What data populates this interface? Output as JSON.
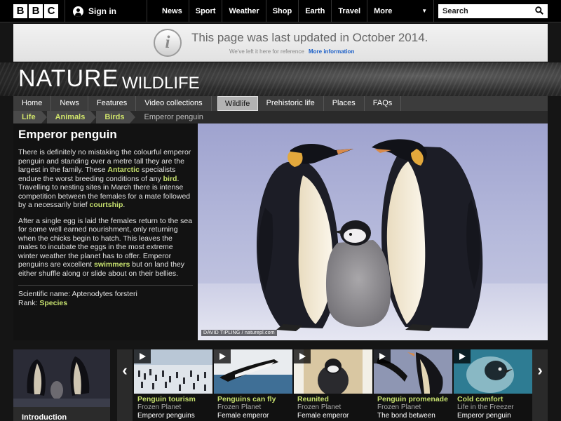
{
  "topbar": {
    "logo_letters": [
      "B",
      "B",
      "C"
    ],
    "signin_label": "Sign in",
    "nav": [
      "News",
      "Sport",
      "Weather",
      "Shop",
      "Earth",
      "Travel"
    ],
    "more_label": "More",
    "search_placeholder": "Search"
  },
  "notice": {
    "message": "This page was last updated in October 2014.",
    "sub_text": "We've left it here for reference",
    "more_info_link": "More information"
  },
  "header": {
    "site_title": "NATURE",
    "section_title": "WILDLIFE"
  },
  "nav": {
    "items": [
      "Home",
      "News",
      "Features",
      "Video collections",
      "Wildlife",
      "Prehistoric life",
      "Places",
      "FAQs"
    ],
    "active": "Wildlife"
  },
  "breadcrumb": [
    "Life",
    "Animals",
    "Birds",
    "Emperor penguin"
  ],
  "article": {
    "title": "Emperor penguin",
    "p1": {
      "t1": "There is definitely no mistaking the colourful emperor penguin and standing over a metre tall they are the largest in the family. These ",
      "link1": "Antarctic",
      "t2": " specialists endure the worst breeding conditions of any ",
      "link2": "bird",
      "t3": ". Travelling to nesting sites in March there is intense competition between the females for a mate followed by a necessarily brief ",
      "link3": "courtship",
      "t4": "."
    },
    "p2": {
      "t1": "After a single egg is laid the females return to the sea for some well earned nourishment, only returning when the chicks begin to hatch. This leaves the males to incubate the eggs in the most extreme winter weather the planet has to offer. Emperor penguins are excellent ",
      "link1": "swimmers",
      "t2": " but on land they either shuffle along or slide about on their bellies."
    },
    "scientific_name_label": "Scientific name: Aptenodytes forsteri",
    "rank_label": "Rank: ",
    "rank_link": "Species"
  },
  "hero": {
    "credit": "DAVID TIPLING / naturepl.com"
  },
  "strip": {
    "feature_label": "Introduction",
    "clips": [
      {
        "title": "Penguin tourism",
        "programme": "Frozen Planet",
        "desc": "Emperor penguins"
      },
      {
        "title": "Penguins can fly",
        "programme": "Frozen Planet",
        "desc": "Female emperor"
      },
      {
        "title": "Reunited",
        "programme": "Frozen Planet",
        "desc": "Female emperor"
      },
      {
        "title": "Penguin promenade",
        "programme": "Frozen Planet",
        "desc": "The bond between"
      },
      {
        "title": "Cold comfort",
        "programme": "Life in the Freezer",
        "desc": "Emperor penguin"
      }
    ],
    "prev_label": "‹",
    "next_label": "›"
  },
  "colors": {
    "accent_link": "#c6e06e",
    "notice_link": "#1a5ec7",
    "nav_active_bg": "#b3b3b3"
  }
}
